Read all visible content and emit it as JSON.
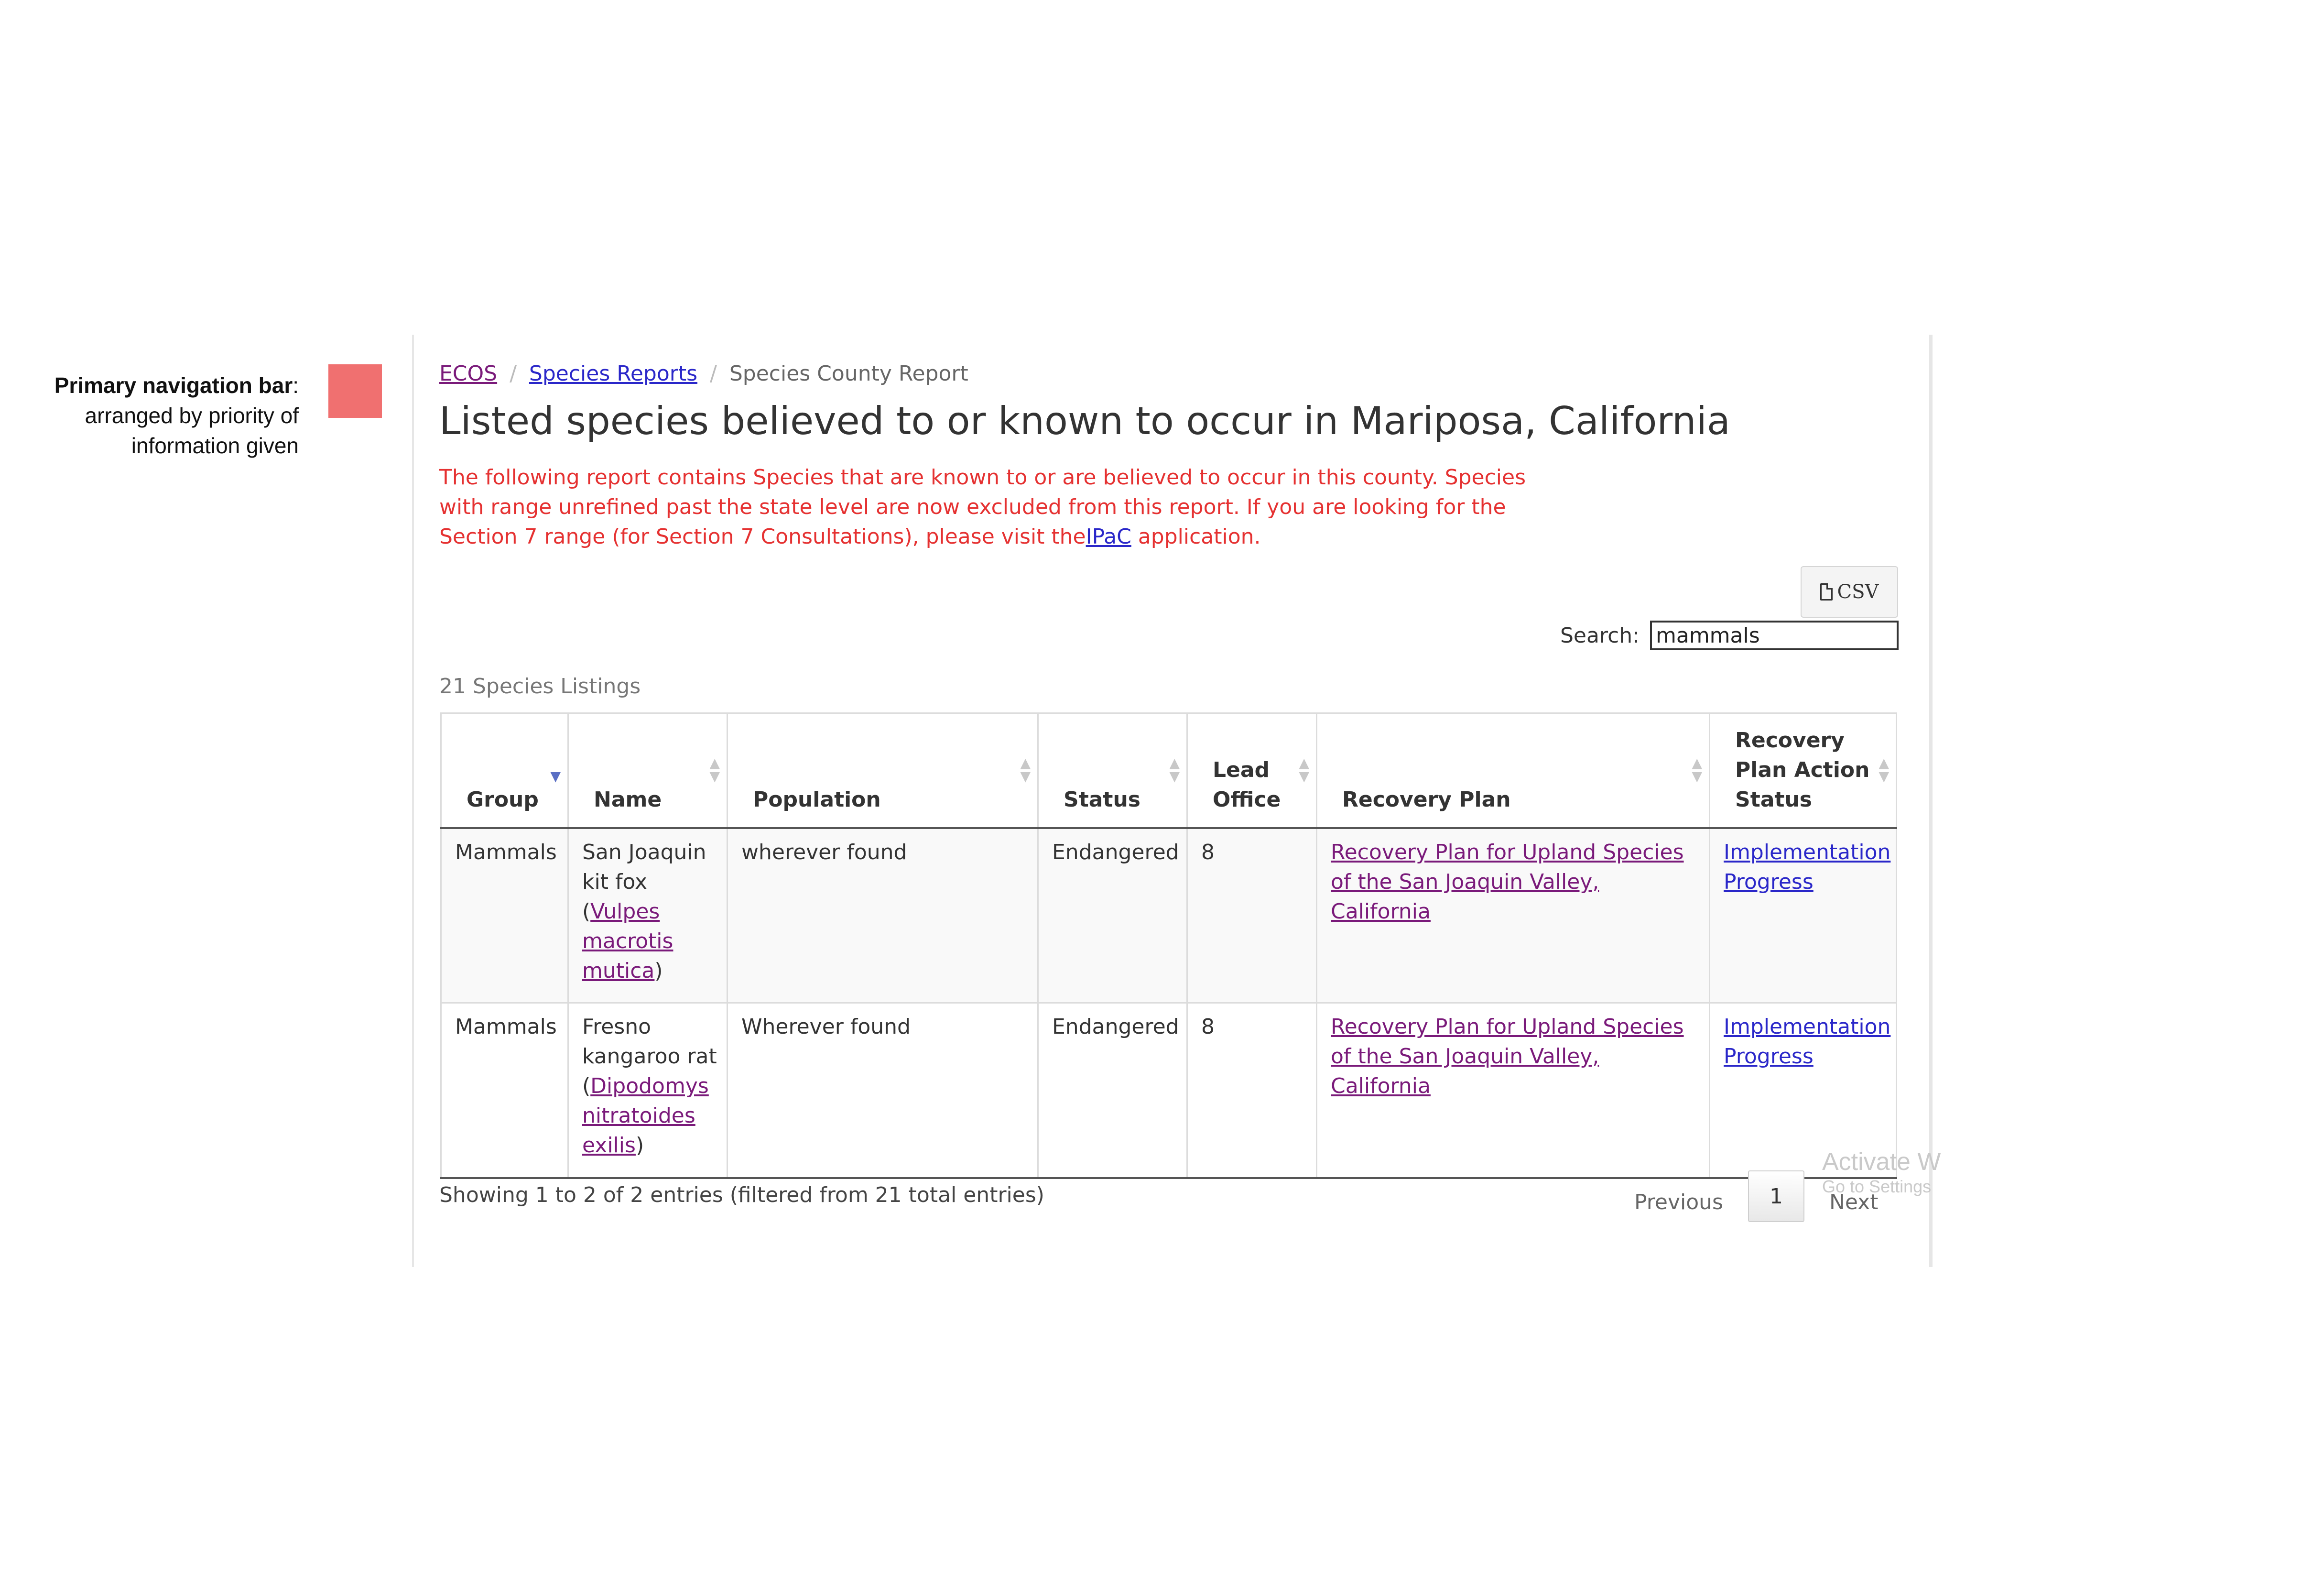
{
  "annotation": {
    "title": "Primary navigation bar",
    "text": ": arranged by priority of information given",
    "swatch_color": "#f07070"
  },
  "breadcrumb": [
    {
      "label": "ECOS",
      "link": true
    },
    {
      "label": "Species Reports",
      "link": true
    },
    {
      "label": "Species County Report",
      "link": false
    }
  ],
  "page_title": "Listed species believed to or known to occur in Mariposa, California",
  "notice": {
    "text_before": "The following report contains Species that are known to or are believed to occur in this county. Species with range unrefined past the state level are now excluded from this report. If you are looking for the Section 7 range (for Section 7 Consultations), please visit the",
    "link": "IPaC",
    "text_after": " application."
  },
  "toolbar": {
    "csv_label": "CSV"
  },
  "search": {
    "label": "Search:",
    "value": "mammals"
  },
  "listing_count": "21 Species Listings",
  "table": {
    "columns": [
      "Group",
      "Name",
      "Population",
      "Status",
      "Lead Office",
      "Recovery Plan",
      "Recovery Plan Action Status"
    ],
    "rows": [
      {
        "group": "Mammals",
        "name": "San Joaquin kit fox",
        "scientific": "Vulpes macrotis mutica",
        "population": "wherever found",
        "status": "Endangered",
        "lead_office": "8",
        "recovery_plan": "Recovery Plan for Upland Species of the San Joaquin Valley, California",
        "action_status": "Implementation Progress"
      },
      {
        "group": "Mammals",
        "name": "Fresno kangaroo rat",
        "scientific": "Dipodomys nitratoides exilis",
        "population": "Wherever found",
        "status": "Endangered",
        "lead_office": "8",
        "recovery_plan": "Recovery Plan for Upland Species of the San Joaquin Valley, California",
        "action_status": "Implementation Progress"
      }
    ]
  },
  "table_info": "Showing 1 to 2 of 2 entries (filtered from 21 total entries)",
  "pagination": {
    "previous": "Previous",
    "current_page": "1",
    "next": "Next"
  },
  "watermark": {
    "line1": "Activate W",
    "line2": "Go to Settings"
  }
}
